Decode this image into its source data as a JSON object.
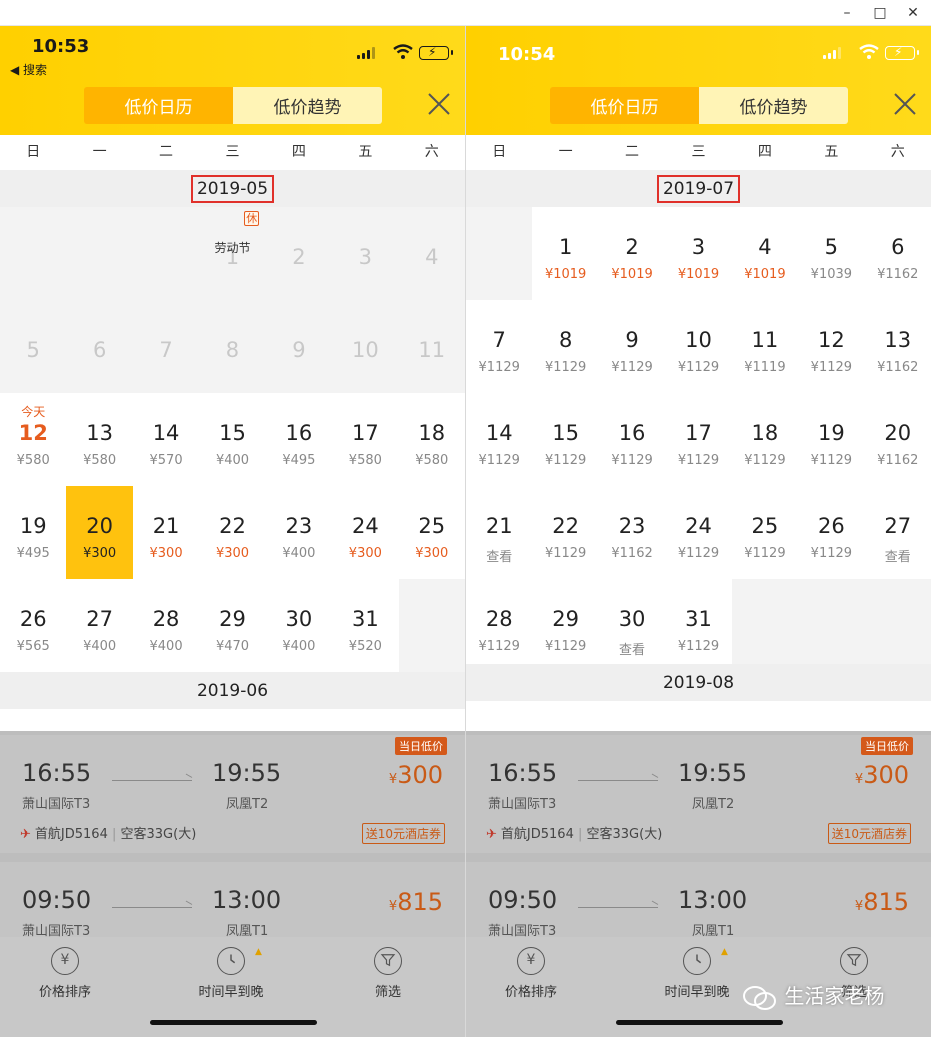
{
  "window": {
    "minimize_label": "–",
    "maximize_label": "□",
    "close_label": "✕"
  },
  "weekdays": [
    "日",
    "一",
    "二",
    "三",
    "四",
    "五",
    "六"
  ],
  "left": {
    "time": "10:53",
    "back_label": "◀ 搜索",
    "tab_calendar": "低价日历",
    "tab_trend": "低价趋势",
    "month1": "2019-05",
    "month2": "2019-06",
    "holiday_badge": "休",
    "holiday_name": "劳动节",
    "today_label": "今天",
    "past_row1": [
      "1",
      "2",
      "3",
      "4"
    ],
    "past_row2": [
      "5",
      "6",
      "7",
      "8",
      "9",
      "10",
      "11"
    ],
    "row3": [
      [
        "12",
        "¥580"
      ],
      [
        "13",
        "¥580"
      ],
      [
        "14",
        "¥570"
      ],
      [
        "15",
        "¥400"
      ],
      [
        "16",
        "¥495"
      ],
      [
        "17",
        "¥580"
      ],
      [
        "18",
        "¥580"
      ]
    ],
    "row4": [
      [
        "19",
        "¥495"
      ],
      [
        "20",
        "¥300"
      ],
      [
        "21",
        "¥300"
      ],
      [
        "22",
        "¥300"
      ],
      [
        "23",
        "¥400"
      ],
      [
        "24",
        "¥300"
      ],
      [
        "25",
        "¥300"
      ]
    ],
    "row5": [
      [
        "26",
        "¥565"
      ],
      [
        "27",
        "¥400"
      ],
      [
        "28",
        "¥400"
      ],
      [
        "29",
        "¥470"
      ],
      [
        "30",
        "¥400"
      ],
      [
        "31",
        "¥520"
      ]
    ]
  },
  "right": {
    "time": "10:54",
    "tab_calendar": "低价日历",
    "tab_trend": "低价趋势",
    "month1": "2019-07",
    "month2": "2019-08",
    "row1": [
      [
        "1",
        "¥1019"
      ],
      [
        "2",
        "¥1019"
      ],
      [
        "3",
        "¥1019"
      ],
      [
        "4",
        "¥1019"
      ],
      [
        "5",
        "¥1039"
      ],
      [
        "6",
        "¥1162"
      ]
    ],
    "row2": [
      [
        "7",
        "¥1129"
      ],
      [
        "8",
        "¥1129"
      ],
      [
        "9",
        "¥1129"
      ],
      [
        "10",
        "¥1129"
      ],
      [
        "11",
        "¥1119"
      ],
      [
        "12",
        "¥1129"
      ],
      [
        "13",
        "¥1162"
      ]
    ],
    "row3": [
      [
        "14",
        "¥1129"
      ],
      [
        "15",
        "¥1129"
      ],
      [
        "16",
        "¥1129"
      ],
      [
        "17",
        "¥1129"
      ],
      [
        "18",
        "¥1129"
      ],
      [
        "19",
        "¥1129"
      ],
      [
        "20",
        "¥1162"
      ]
    ],
    "row4": [
      [
        "21",
        "查看"
      ],
      [
        "22",
        "¥1129"
      ],
      [
        "23",
        "¥1162"
      ],
      [
        "24",
        "¥1129"
      ],
      [
        "25",
        "¥1129"
      ],
      [
        "26",
        "¥1129"
      ],
      [
        "27",
        "查看"
      ]
    ],
    "row5": [
      [
        "28",
        "¥1129"
      ],
      [
        "29",
        "¥1129"
      ],
      [
        "30",
        "查看"
      ],
      [
        "31",
        "¥1129"
      ]
    ]
  },
  "flights": [
    {
      "dep": "16:55",
      "dep_airport": "萧山国际T3",
      "arr": "19:55",
      "arr_airport": "凤凰T2",
      "price": "300",
      "tag": "当日低价",
      "airline": "首航JD5164",
      "aircraft": "空客33G(大)",
      "coupon": "送10元酒店券"
    },
    {
      "dep": "09:50",
      "dep_airport": "萧山国际T3",
      "arr": "13:00",
      "arr_airport": "凤凰T1",
      "price": "815"
    }
  ],
  "currency": "¥",
  "bottom": {
    "sort_price": "价格排序",
    "sort_time": "时间早到晚",
    "filter": "筛选",
    "yen_icon": "¥"
  },
  "watermark": "生活家老杨",
  "colors": {
    "header": "#ffd000",
    "accent": "#ffb400",
    "low_price": "#e65c1e",
    "selected": "#ffc20e",
    "highlight_box": "#e0302a"
  }
}
